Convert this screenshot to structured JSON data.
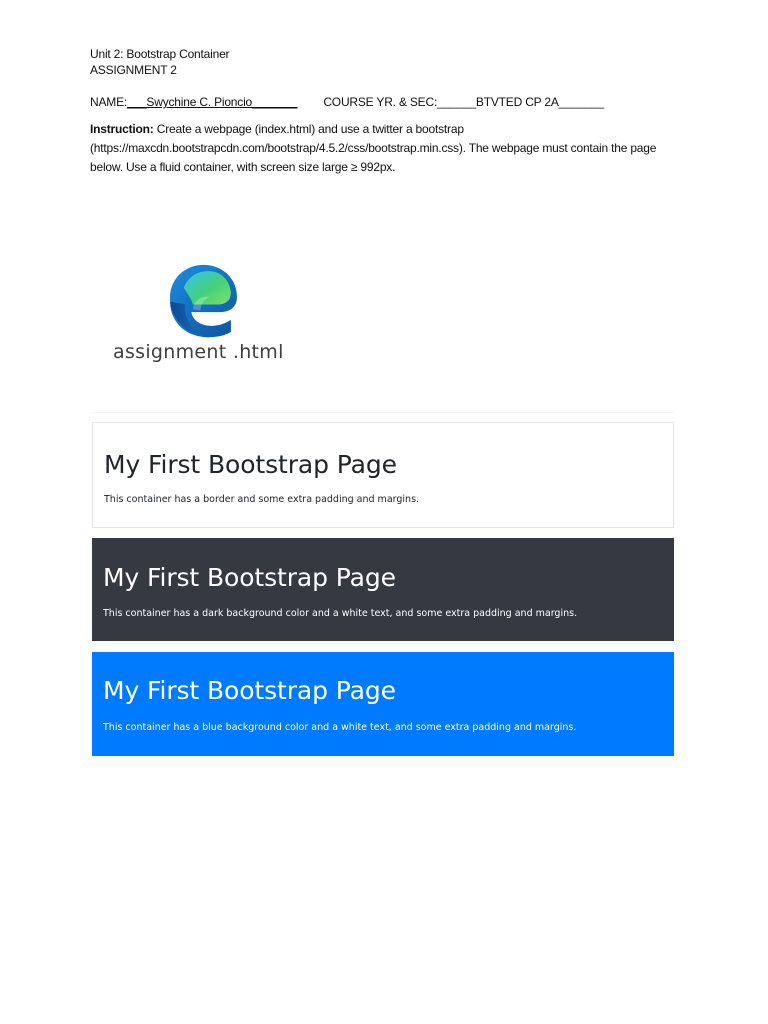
{
  "document": {
    "unit_line": "Unit 2: Bootstrap Container",
    "assignment_line": "ASSIGNMENT 2",
    "name_label": "NAME:",
    "name_value": "___Swychine C. Pioncio_______",
    "course_label": "COURSE YR. & SEC: ",
    "course_value": "______BTVTED CP 2A_______",
    "instruction_label": "Instruction:",
    "instruction_text": " Create a webpage (index.html) and use a twitter a bootstrap (https://maxcdn.bootstrapcdn.com/bootstrap/4.5.2/css/bootstrap.min.css). The webpage must contain the page below. Use a fluid container, with screen size large ≥ 992px."
  },
  "file_icon": {
    "icon": "edge-browser-icon",
    "label": "assignment .html"
  },
  "panels": [
    {
      "heading": "My First Bootstrap Page",
      "text": "This container has a border and some extra padding and margins."
    },
    {
      "heading": "My First Bootstrap Page",
      "text": "This container has a dark background color and a white text, and some extra padding and margins."
    },
    {
      "heading": "My First Bootstrap Page",
      "text": "This container has a blue background color and a white text, and some extra padding and margins."
    }
  ],
  "colors": {
    "dark_panel": "#343a40",
    "blue_panel": "#007bff",
    "border_panel_border": "#e4e4e4"
  }
}
